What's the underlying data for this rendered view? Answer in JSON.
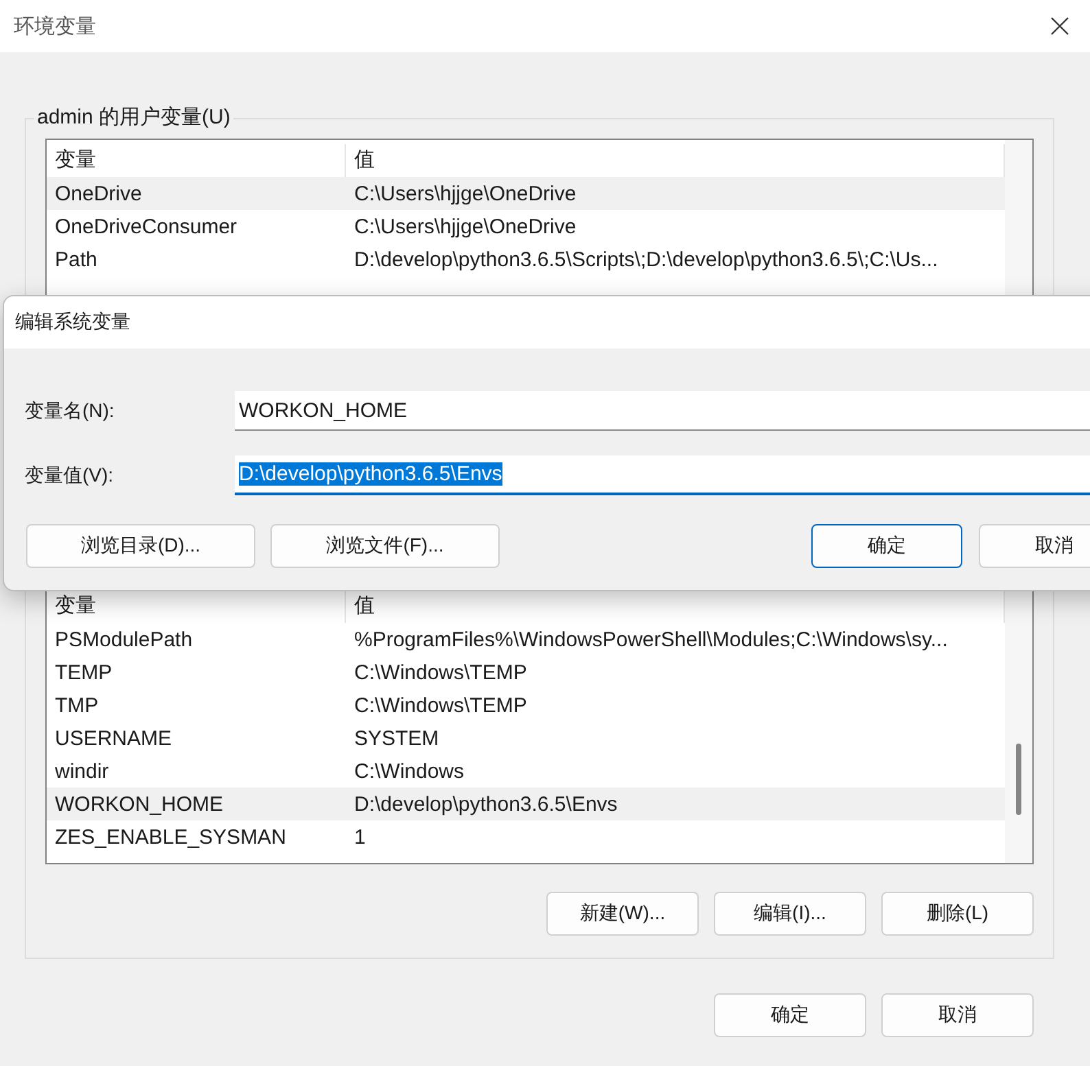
{
  "window": {
    "title": "环境变量"
  },
  "user_variables": {
    "title": "admin 的用户变量(U)",
    "columns": [
      "变量",
      "值"
    ],
    "rows": [
      {
        "name": "OneDrive",
        "value": "C:\\Users\\hjjge\\OneDrive",
        "selected": true
      },
      {
        "name": "OneDriveConsumer",
        "value": "C:\\Users\\hjjge\\OneDrive",
        "selected": false
      },
      {
        "name": "Path",
        "value": "D:\\develop\\python3.6.5\\Scripts\\;D:\\develop\\python3.6.5\\;C:\\Us...",
        "selected": false
      }
    ]
  },
  "system_variables": {
    "columns": [
      "变量",
      "值"
    ],
    "rows": [
      {
        "name": "PSModulePath",
        "value": "%ProgramFiles%\\WindowsPowerShell\\Modules;C:\\Windows\\sy...",
        "selected": false
      },
      {
        "name": "TEMP",
        "value": "C:\\Windows\\TEMP",
        "selected": false
      },
      {
        "name": "TMP",
        "value": "C:\\Windows\\TEMP",
        "selected": false
      },
      {
        "name": "USERNAME",
        "value": "SYSTEM",
        "selected": false
      },
      {
        "name": "windir",
        "value": "C:\\Windows",
        "selected": false
      },
      {
        "name": "WORKON_HOME",
        "value": "D:\\develop\\python3.6.5\\Envs",
        "selected": true
      },
      {
        "name": "ZES_ENABLE_SYSMAN",
        "value": "1",
        "selected": false
      }
    ],
    "buttons": [
      "新建(W)...",
      "编辑(I)...",
      "删除(L)"
    ]
  },
  "buttons": [
    {
      "label": "确定",
      "default": false
    },
    {
      "label": "取消",
      "default": false
    }
  ],
  "edit_dialog": {
    "title": "编辑系统变量",
    "name_field": {
      "label": "变量名(N):",
      "value": "WORKON_HOME",
      "focused": false,
      "text_selected": false
    },
    "value_field": {
      "label": "变量值(V):",
      "value": "D:\\develop\\python3.6.5\\Envs",
      "focused": true,
      "text_selected": true
    },
    "buttons": [
      {
        "label": "浏览目录(D)...",
        "default": false
      },
      {
        "label": "浏览文件(F)...",
        "default": false
      },
      {
        "label": "确定",
        "default": true
      },
      {
        "label": "取消",
        "default": false
      }
    ]
  }
}
